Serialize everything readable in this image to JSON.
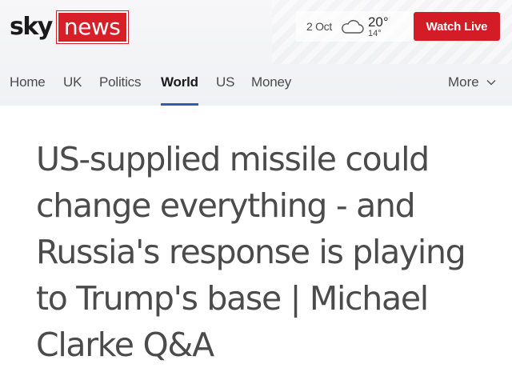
{
  "header": {
    "logo": {
      "sky": "sky",
      "news": "news"
    },
    "weather": {
      "date": "2 Oct",
      "icon": "cloud-icon",
      "high": "20°",
      "low": "14°"
    },
    "watch_live": "Watch Live"
  },
  "nav": {
    "items": [
      {
        "label": "Home"
      },
      {
        "label": "UK"
      },
      {
        "label": "Politics"
      },
      {
        "label": "World",
        "active": true
      },
      {
        "label": "US"
      },
      {
        "label": "Money"
      }
    ],
    "more": "More",
    "accent": "#2f5bbd"
  },
  "article": {
    "headline": "US-supplied missile could change everything - and Russia's response is playing to Trump's base | Michael Clarke Q&A"
  },
  "colors": {
    "brand_red": "#d41c26",
    "text": "#4b4b4b"
  }
}
